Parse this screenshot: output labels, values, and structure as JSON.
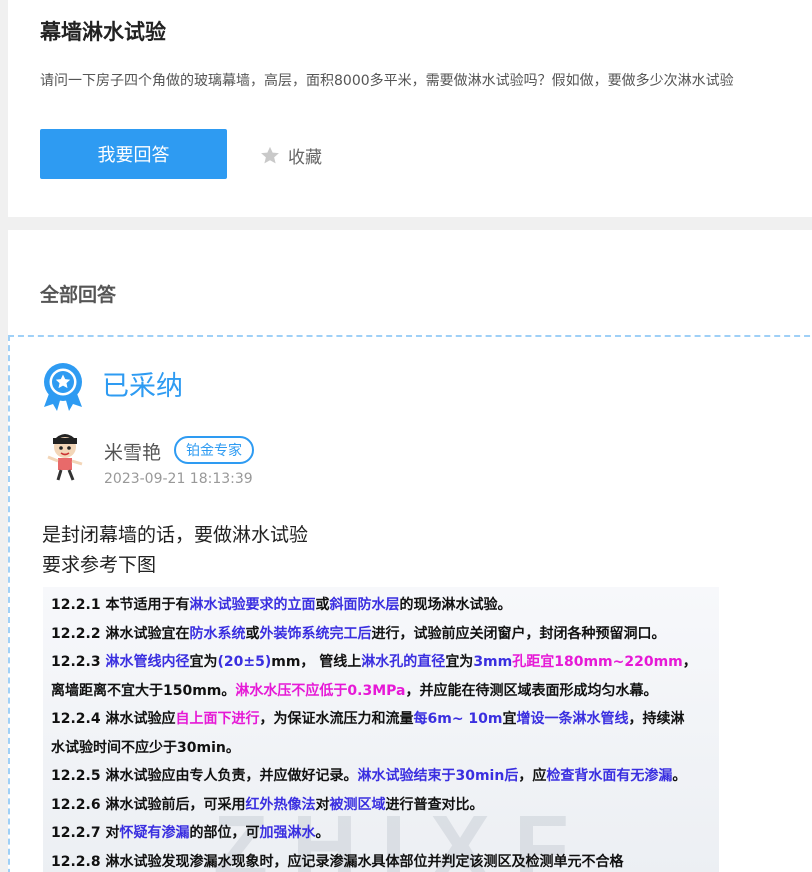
{
  "question": {
    "title": "幕墙淋水试验",
    "description": "请问一下房子四个角做的玻璃幕墙，高层，面积8000多平米，需要做淋水试验吗？假如做，要做多少次淋水试验",
    "answer_button": "我要回答",
    "favorite_label": "收藏"
  },
  "answers": {
    "heading": "全部回答",
    "accepted_label": "已采纳",
    "user": {
      "name": "米雪艳",
      "badge": "铂金专家",
      "time": "2023-09-21 18:13:39"
    },
    "text_line1": "是封闭幕墙的话，要做淋水试验",
    "text_line2": "要求参考下图"
  },
  "spec_image": {
    "watermark": "ZHIXF",
    "l1": [
      "12.2.1 本节适用于有",
      "淋水试验要求的立面",
      "或",
      "斜面防水层",
      "的现场淋水试验。"
    ],
    "l2": [
      "12.2.2 淋水试验宜在",
      "防水系统",
      "或",
      "外装饰系统完工后",
      "进行，试验前应关闭窗户，封闭各种预留洞口。"
    ],
    "l3": [
      "12.2.3 ",
      "淋水管线内径",
      "宜为",
      "(20±5)",
      "mm， 管线上",
      "淋水孔的直径",
      "宜为",
      "3mm",
      "孔距宜180mm~220mm",
      "，"
    ],
    "l4": [
      "离墙距离不宜大于150mm。",
      "淋水水压不应低于0.3MPa",
      "，并应能在待测区域表面形成均匀水幕。"
    ],
    "l5": [
      "12.2.4 淋水试验应",
      "自上面下进行",
      "，为保证水流压力和流量",
      "每6m~ 10m",
      "宜",
      "增设一条淋水管线",
      "，持续淋"
    ],
    "l6": [
      "水试验时间不应少于30min。"
    ],
    "l7": [
      "12.2.5 淋水试验应由专人负责，并应做好记录。",
      "淋水试验结束于30min后",
      "，应",
      "检查背水面有无渗漏",
      "。"
    ],
    "l8": [
      "12.2.6 淋水试验前后，可采用",
      "红外热像法",
      "对",
      "被测区域",
      "进行普查对比。"
    ],
    "l9": [
      "12.2.7 对",
      "怀疑有渗漏",
      "的部位，可",
      "加强淋水",
      "。"
    ],
    "l10": [
      "12.2.8 淋水试验发现渗漏水现象时，应记录渗漏水具体部位并判定该测区及检测单元不合格"
    ]
  },
  "colors": {
    "accent": "#2e9bf2",
    "highlight_blue": "#3a2fe0",
    "highlight_pink": "#e619d6"
  },
  "icons": [
    "star-icon",
    "medal-icon",
    "avatar"
  ]
}
